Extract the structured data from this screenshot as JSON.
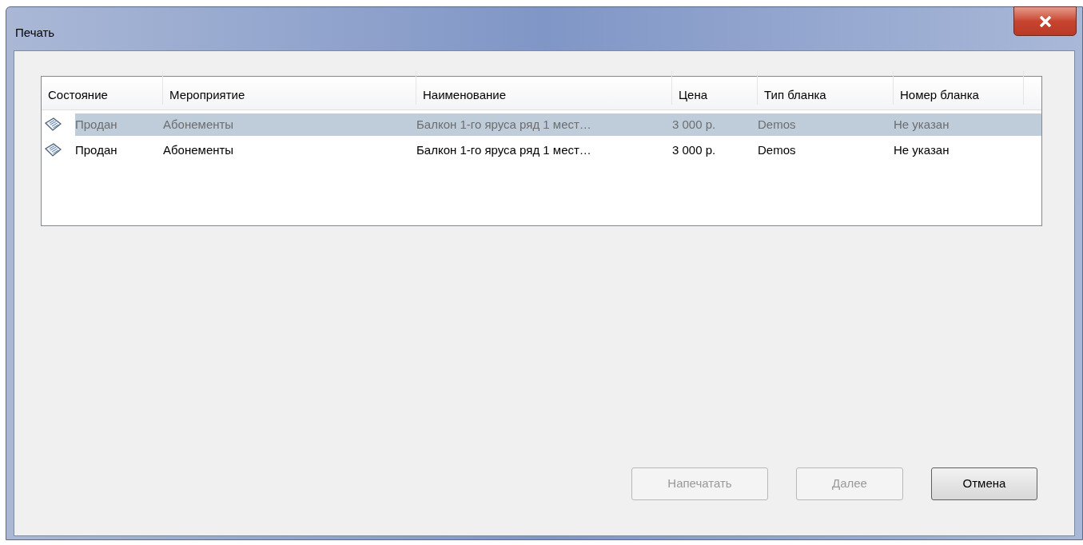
{
  "window": {
    "title": "Печать"
  },
  "table": {
    "columns": [
      "Состояние",
      "Мероприятие",
      "Наименование",
      "Цена",
      "Тип бланка",
      "Номер бланка"
    ],
    "rows": [
      {
        "selected": true,
        "cells": [
          "Продан",
          "Абонементы",
          "Балкон 1-го яруса ряд 1 мест…",
          "3 000 р.",
          "Demos",
          "Не указан"
        ]
      },
      {
        "selected": false,
        "cells": [
          "Продан",
          "Абонементы",
          "Балкон 1-го яруса ряд 1 мест…",
          "3 000 р.",
          "Demos",
          "Не указан"
        ]
      }
    ]
  },
  "buttons": [
    {
      "label": "Напечатать",
      "disabled": true
    },
    {
      "label": "Далее",
      "disabled": true
    },
    {
      "label": "Отмена",
      "disabled": false
    }
  ]
}
